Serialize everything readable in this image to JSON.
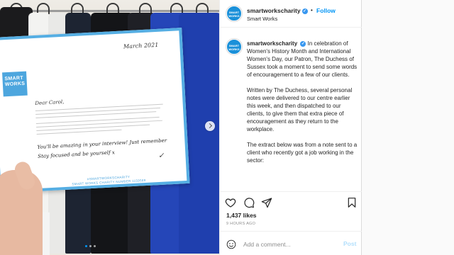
{
  "colors": {
    "accent": "#0095f6",
    "brand": "#1a90d9",
    "card_border": "#55aee3",
    "post_disabled": "#b2dffc"
  },
  "post": {
    "username": "smartworkscharity",
    "location": "Smart Works",
    "follow_label": "Follow",
    "separator": "•",
    "avatar_text": "SMART WORKS",
    "caption_paragraphs": [
      "In celebration of Women's History Month and International Women's Day, our Patron, The Duchess of Sussex took a moment to send some words of encouragement to a few of our clients.",
      "Written by The Duchess, several personal notes were delivered to our centre earlier this week, and then dispatched to our clients, to give them that extra piece of encouragement as they return to the workplace.",
      "The extract below was from a note sent to a client who recently got a job working in the sector:"
    ],
    "likes": "1,437 likes",
    "time": "9 HOURS AGO",
    "comment_placeholder": "Add a comment...",
    "post_label": "Post",
    "carousel": {
      "slides": 3,
      "active": 1
    }
  },
  "photo_card": {
    "logo": "SMART WORKS",
    "date": "March 2021",
    "greeting": "Dear Carol,",
    "script_line1": "You'll be amazing in your interview! Just remember",
    "script_line2": "Stay focused and be yourself x",
    "footer1": "#SMARTWORKSCHARITY",
    "footer2": "SMART WORKS CHARITY NUMBER 1159569"
  },
  "icons": [
    "like-icon",
    "comment-icon",
    "share-icon",
    "save-icon",
    "emoji-icon",
    "verified-icon",
    "chevron-right-icon"
  ]
}
